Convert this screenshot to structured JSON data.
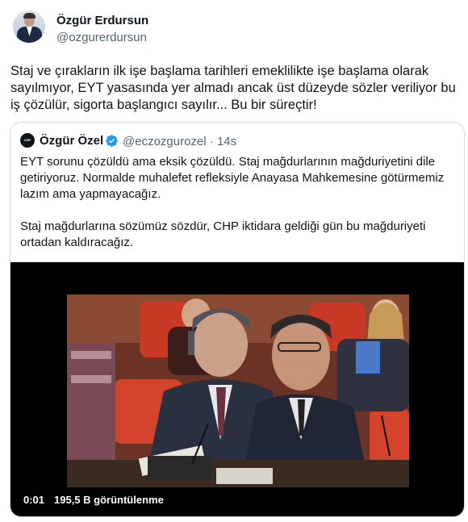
{
  "tweet": {
    "author": {
      "name": "Özgür Erdursun",
      "handle": "@ozgurerdursun"
    },
    "text": "Staj ve çırakların ilk işe başlama tarihleri emeklilikte işe başlama olarak sayılmıyor, EYT yasasında yer almadı ancak üst düzeyde sözler veriliyor bu iş çözülür, sigorta başlangıcı sayılır... Bu bir süreçtir!"
  },
  "quote": {
    "author": {
      "name": "Özgür Özel",
      "handle": "@eczozgurozel",
      "time": " · 14s",
      "avatar_text": "CHP"
    },
    "paragraph1": "EYT sorunu çözüldü ama eksik çözüldü. Staj mağdurlarının mağduriyetini dile getiriyoruz. Normalde muhalefet refleksiyle Anayasa Mahkemesine götürmemiz lazım ama yapmayacağız.",
    "paragraph2": "Staj mağdurlarına sözümüz sözdür, CHP iktidara geldiği gün bu mağduriyeti ortadan kaldıracağız."
  },
  "video": {
    "elapsed": "0:01",
    "views": "195,5 B görüntülenme"
  },
  "colors": {
    "text": "#0f1419",
    "secondary": "#536471",
    "verified": "#1d9bf0",
    "border": "#cfd9de"
  }
}
